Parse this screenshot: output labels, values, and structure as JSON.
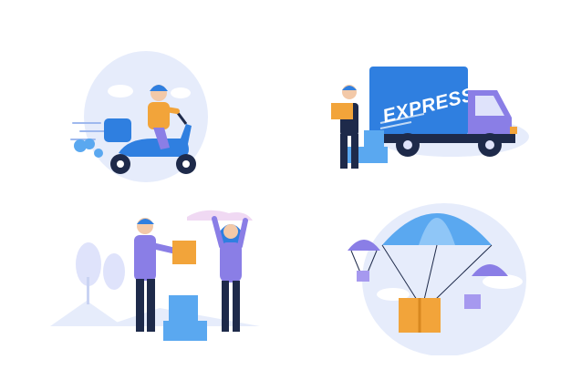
{
  "scenes": {
    "truck": {
      "label": "EXPRESS"
    }
  },
  "colors": {
    "blue": "#2f7fe0",
    "purple": "#8a7ee6",
    "orange": "#f2a43a",
    "navy": "#1e2a4a",
    "sky": "#e6ecfb"
  }
}
